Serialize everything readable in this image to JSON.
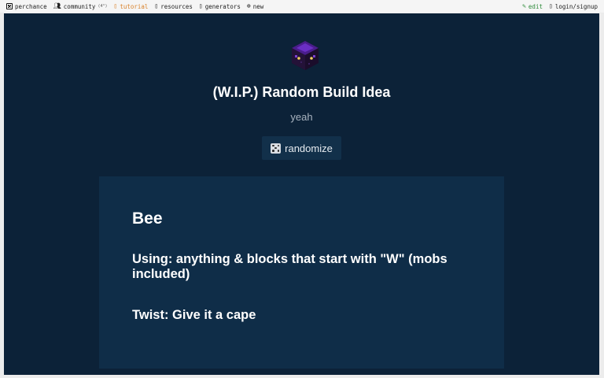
{
  "topnav": {
    "left": [
      {
        "label": "perchance",
        "icon": "dice-icon"
      },
      {
        "label": "community",
        "icon": "person-icon",
        "badge": "(4°)"
      },
      {
        "label": "tutorial",
        "icon": "book-icon"
      },
      {
        "label": "resources",
        "icon": "link-icon"
      },
      {
        "label": "generators",
        "icon": "list-icon"
      },
      {
        "label": "new",
        "icon": "plus-circle-icon"
      }
    ],
    "right": [
      {
        "label": "edit",
        "icon": "pencil-icon"
      },
      {
        "label": "login/signup",
        "icon": "user-icon"
      }
    ]
  },
  "generator": {
    "title": "(W.I.P.) Random Build Idea",
    "subtitle": "yeah",
    "randomize_label": "randomize",
    "output": {
      "subject": "Bee",
      "using": "Using: anything & blocks that start with \"W\" (mobs included)",
      "twist": "Twist: Give it a cape"
    }
  },
  "colors": {
    "panel_bg": "#0c2238",
    "output_bg": "#0f2d48",
    "tutorial_link": "#d9822b",
    "edit_link": "#2e8b3a"
  }
}
